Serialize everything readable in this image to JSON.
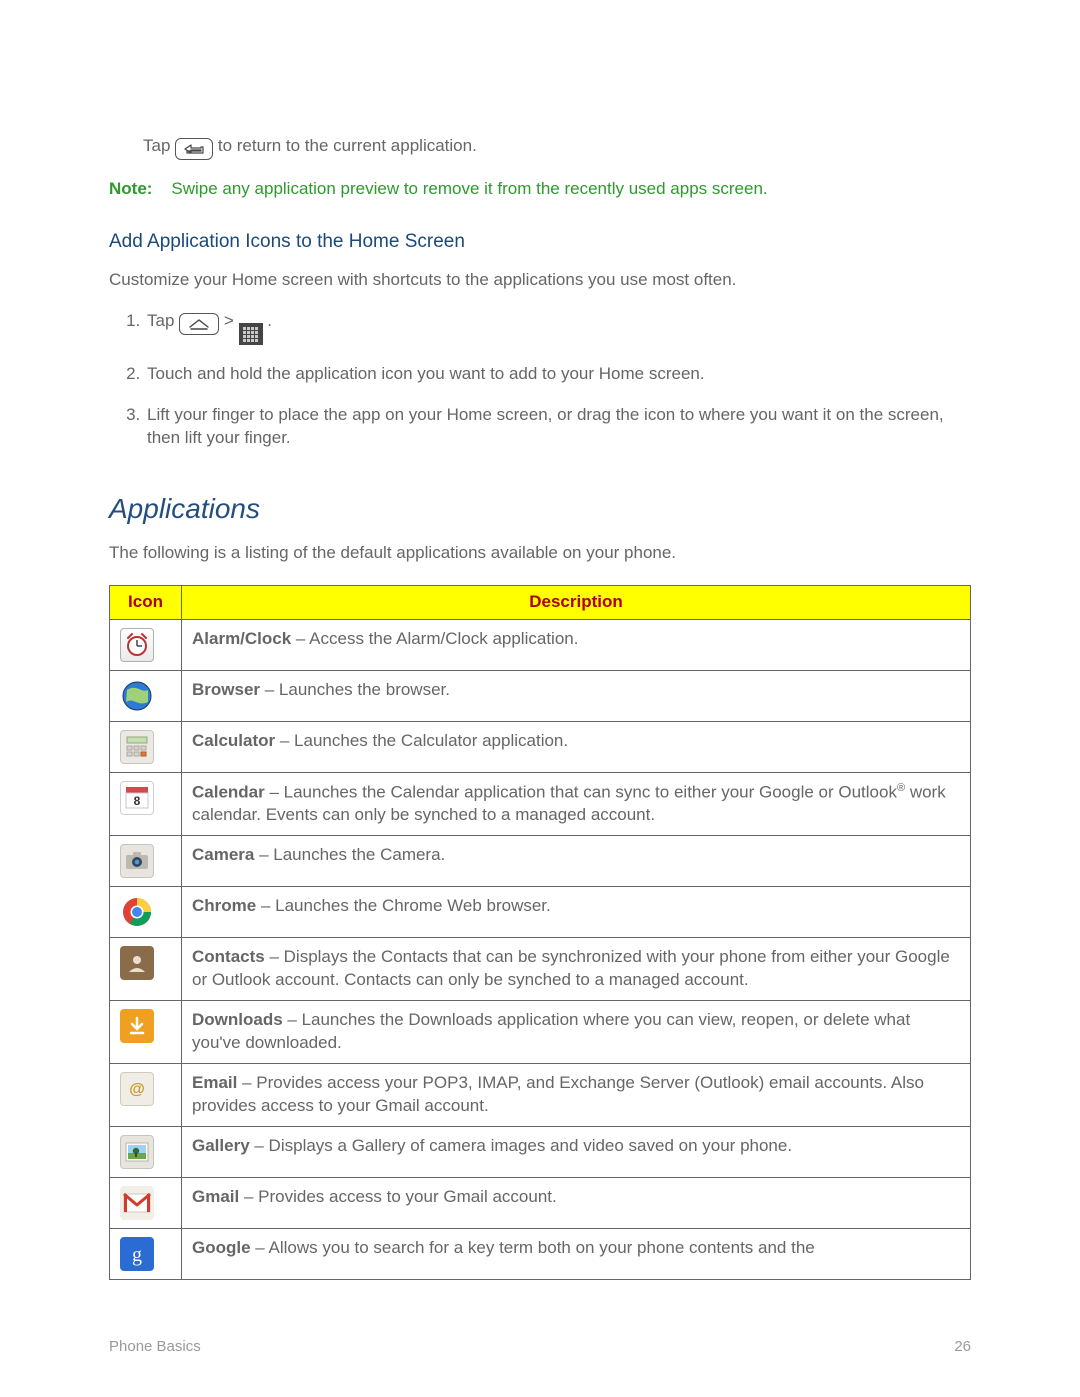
{
  "intro": {
    "tap_prefix": "Tap ",
    "tap_suffix": " to return to the current application."
  },
  "note": {
    "label": "Note:",
    "text": "Swipe any application preview to remove it from the recently used apps screen."
  },
  "subhead": "Add Application Icons to the Home Screen",
  "customize_para": "Customize your Home screen with shortcuts to the applications you use most often.",
  "steps": {
    "s1_prefix": "Tap ",
    "s1_suffix": ".",
    "s2": "Touch and hold the application icon you want to add to your Home screen.",
    "s3": "Lift your finger to place the app on your Home screen, or drag the icon to where you want it on the screen, then lift your finger."
  },
  "section_title": "Applications",
  "section_intro": "The following is a listing of the default applications available on your phone.",
  "table": {
    "head_icon": "Icon",
    "head_desc": "Description",
    "rows": [
      {
        "name": "Alarm/Clock",
        "desc": " – Access the Alarm/Clock application."
      },
      {
        "name": "Browser",
        "desc": " – Launches the browser."
      },
      {
        "name": "Calculator",
        "desc": " – Launches the Calculator application."
      },
      {
        "name": "Calendar",
        "desc_pre": " – Launches the Calendar application that can sync to either your Google or Outlook",
        "reg": "®",
        "desc_post": " work calendar. Events can only be synched to a managed account."
      },
      {
        "name": "Camera",
        "desc": " – Launches the Camera."
      },
      {
        "name": "Chrome",
        "desc": " – Launches the Chrome Web browser."
      },
      {
        "name": "Contacts",
        "desc": " – Displays the Contacts that can be synchronized with your phone from either your Google or Outlook account. Contacts can only be synched to a managed account."
      },
      {
        "name": "Downloads",
        "desc": " – Launches the Downloads application where you can view, reopen, or delete what you've downloaded."
      },
      {
        "name": "Email",
        "desc": " – Provides access your POP3, IMAP, and Exchange Server (Outlook) email accounts. Also provides access to your Gmail account."
      },
      {
        "name": "Gallery",
        "desc": " – Displays a Gallery of camera images and video saved on your phone."
      },
      {
        "name": "Gmail",
        "desc": " – Provides access to your Gmail account."
      },
      {
        "name": "Google",
        "desc": " – Allows you to search for a key term both on your phone contents and the"
      }
    ]
  },
  "footer": {
    "left": "Phone Basics",
    "right": "26"
  }
}
